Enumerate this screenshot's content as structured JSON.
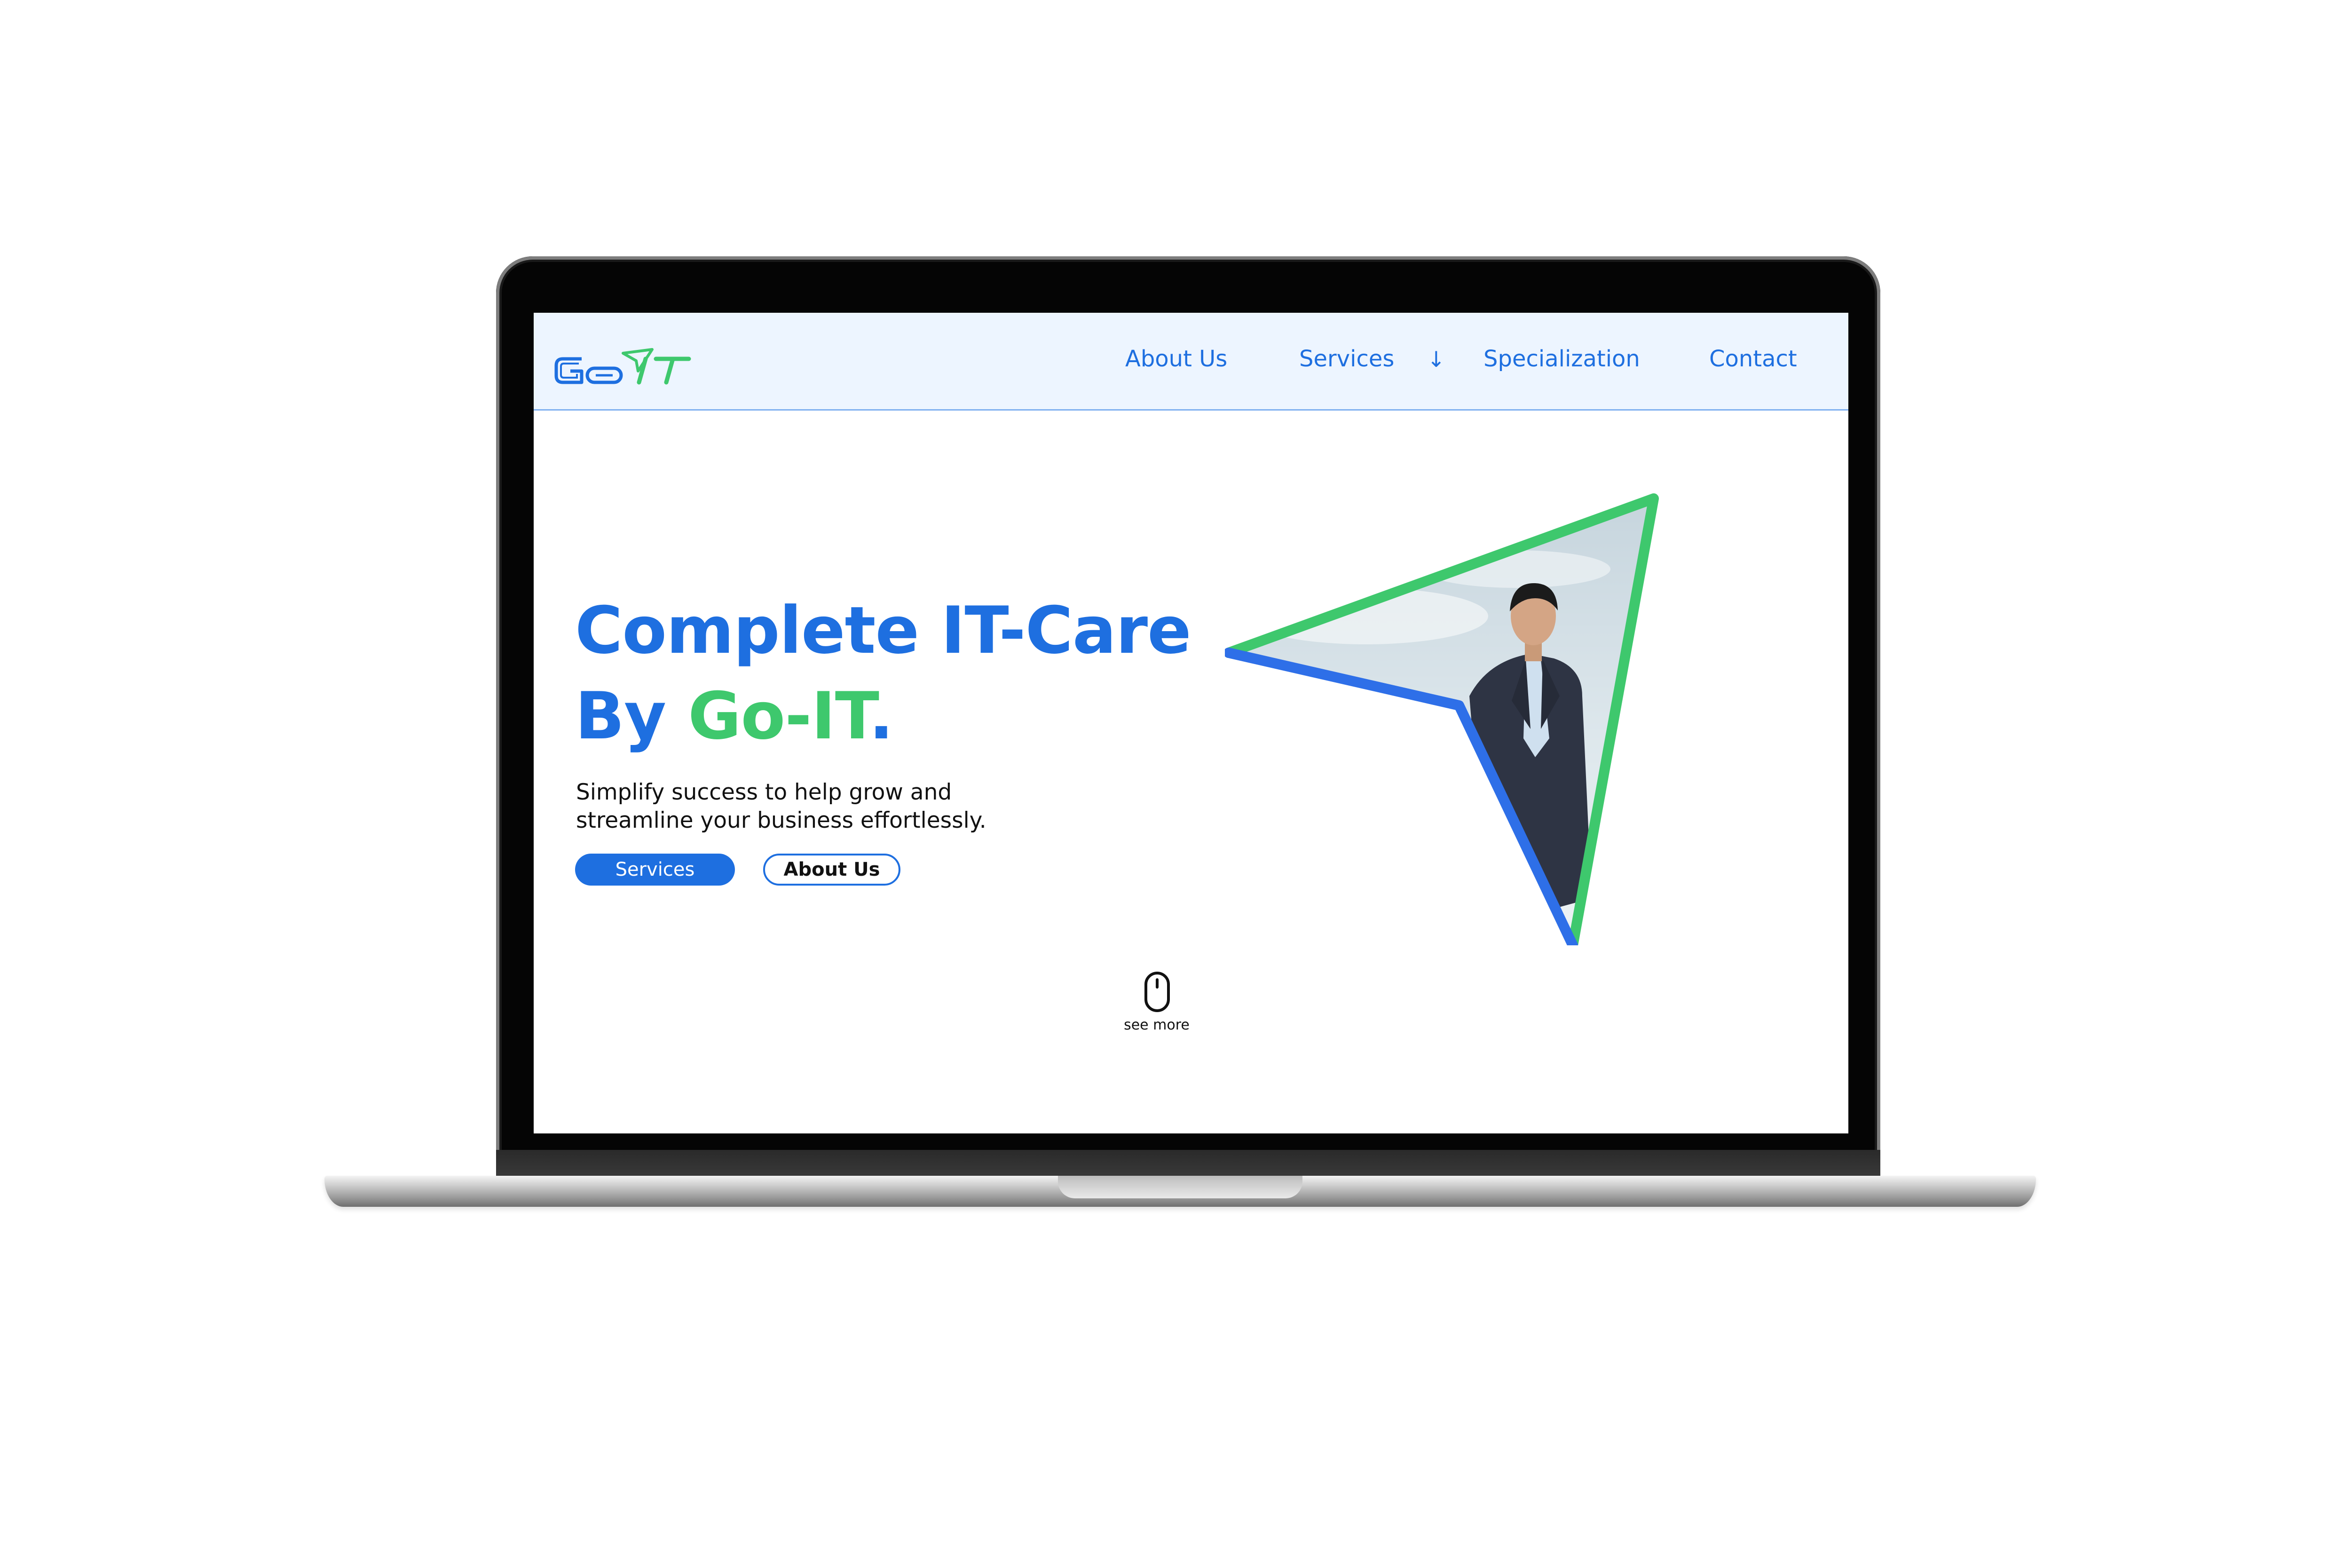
{
  "brand": {
    "logo_text": "GoIT",
    "primary_color": "#1e6fe0",
    "accent_color": "#3ec86d",
    "nav_background": "#edf5ff"
  },
  "nav": {
    "items": [
      {
        "label": "About Us"
      },
      {
        "label": "Services",
        "icon": "arrow-down-icon",
        "arrow": "↓"
      },
      {
        "label": "Specialization"
      },
      {
        "label": "Contact"
      }
    ]
  },
  "hero": {
    "title_line1": "Complete IT-Care",
    "title_line2_prefix": "By ",
    "title_line2_brand": "Go-IT",
    "title_line2_suffix": ".",
    "subtitle_line1": "Simplify success to help grow and",
    "subtitle_line2": "streamline your business effortlessly.",
    "primary_button": "Services",
    "secondary_button": "About Us",
    "image_icon": "businessman-photo-in-triangle"
  },
  "scroll_hint": {
    "icon": "mouse-icon",
    "label": "see more"
  }
}
